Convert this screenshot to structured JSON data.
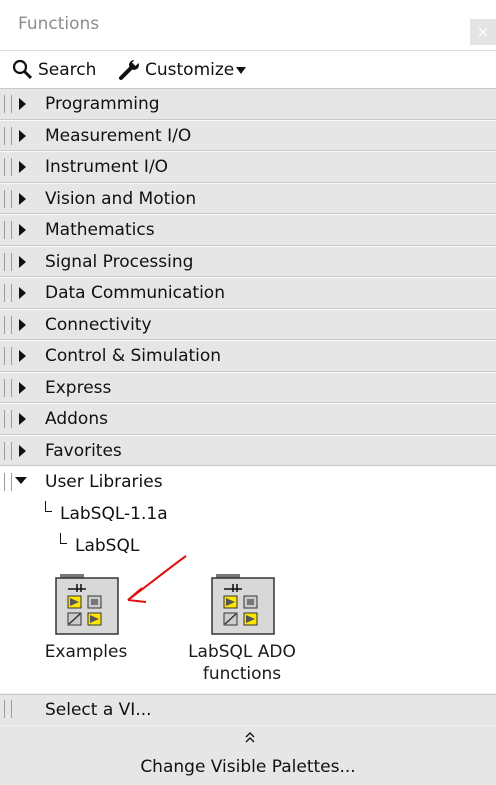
{
  "window": {
    "title": "Functions",
    "close_icon": "×"
  },
  "toolbar": {
    "search_label": "Search",
    "customize_label": "Customize"
  },
  "categories": [
    {
      "label": "Programming"
    },
    {
      "label": "Measurement I/O"
    },
    {
      "label": "Instrument I/O"
    },
    {
      "label": "Vision and Motion"
    },
    {
      "label": "Mathematics"
    },
    {
      "label": "Signal Processing"
    },
    {
      "label": "Data Communication"
    },
    {
      "label": "Connectivity"
    },
    {
      "label": "Control & Simulation"
    },
    {
      "label": "Express"
    },
    {
      "label": "Addons"
    },
    {
      "label": "Favorites"
    }
  ],
  "user_libraries": {
    "label": "User Libraries",
    "tree": [
      "LabSQL-1.1a",
      "LabSQL"
    ],
    "items": [
      {
        "label_line1": "Examples",
        "label_line2": ""
      },
      {
        "label_line1": "LabSQL ADO",
        "label_line2": "functions"
      }
    ]
  },
  "footer": {
    "select_vi_label": "Select a VI...",
    "expand_icon": "≈",
    "change_palettes_label": "Change Visible Palettes..."
  },
  "colors": {
    "annotation_arrow": "#e01010",
    "accent_yellow": "#ffe600"
  }
}
